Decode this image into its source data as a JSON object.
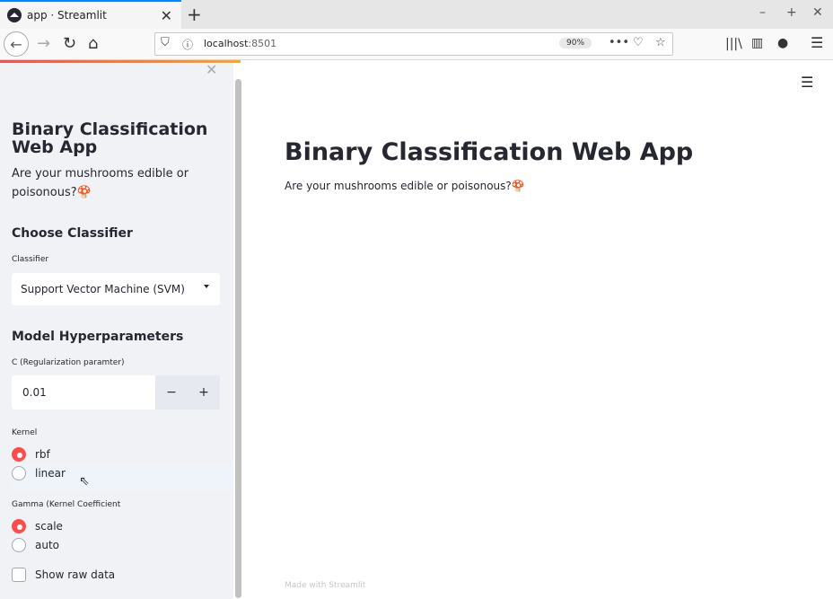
{
  "browser": {
    "tab_title": "app · Streamlit",
    "url_host": "localhost",
    "url_port": ":8501",
    "zoom": "90%"
  },
  "sidebar": {
    "title": "Binary Classification Web App",
    "subtitle": "Are your mushrooms edible or poisonous?🍄",
    "classifier_header": "Choose Classifier",
    "classifier_label": "Classifier",
    "classifier_value": "Support Vector Machine (SVM)",
    "hyper_header": "Model Hyperparameters",
    "c_label": "C (Regularization paramter)",
    "c_value": "0.01",
    "minus": "−",
    "plus": "+",
    "kernel_label": "Kernel",
    "kernel_options": [
      "rbf",
      "linear"
    ],
    "kernel_selected": "rbf",
    "gamma_label": "Gamma (Kernel Coefficient",
    "gamma_options": [
      "scale",
      "auto"
    ],
    "gamma_selected": "scale",
    "raw_data_label": "Show raw data",
    "raw_data_checked": false
  },
  "main": {
    "title": "Binary Classification Web App",
    "subtitle": "Are your mushrooms edible or poisonous?🍄",
    "footer": "Made with Streamlit"
  },
  "colors": {
    "accent": "#ff4b4b",
    "sidebar_bg": "#f0f2f6",
    "text": "#262730"
  }
}
